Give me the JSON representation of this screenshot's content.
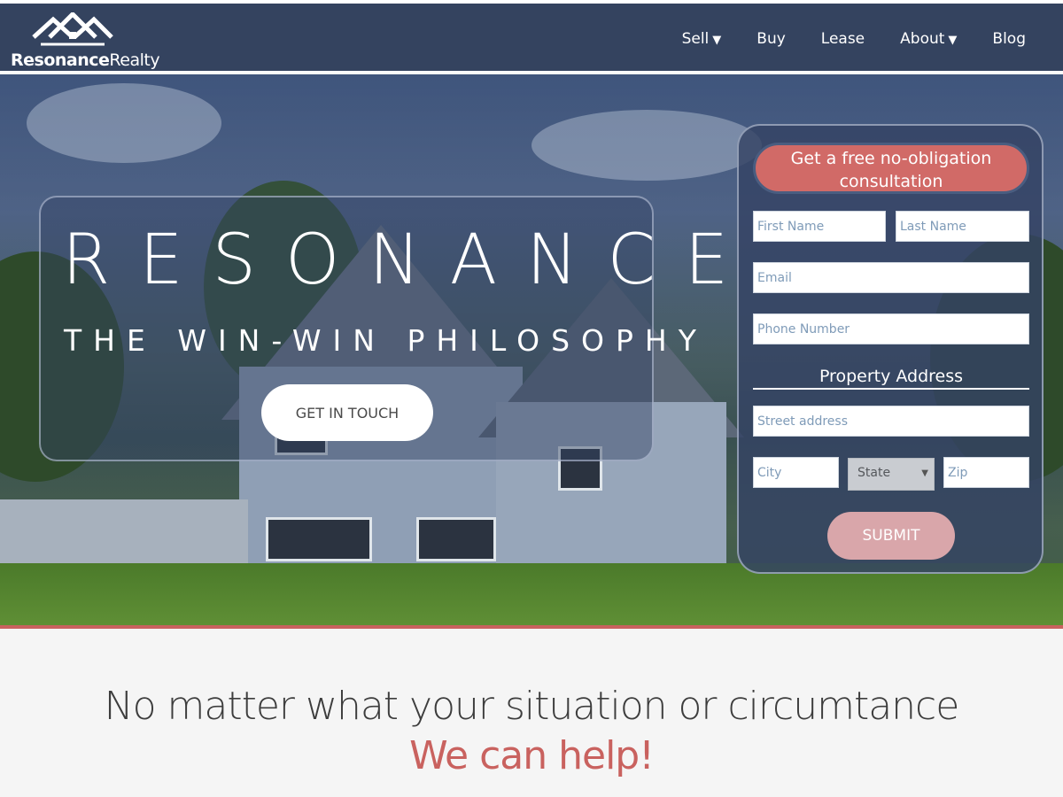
{
  "brand": {
    "name_bold": "Resonance",
    "name_light": "Realty",
    "logo_icon": "house-roofs-icon"
  },
  "nav": {
    "items": [
      {
        "label": "Sell",
        "has_dropdown": true
      },
      {
        "label": "Buy",
        "has_dropdown": false
      },
      {
        "label": "Lease",
        "has_dropdown": false
      },
      {
        "label": "About",
        "has_dropdown": true
      },
      {
        "label": "Blog",
        "has_dropdown": false
      }
    ],
    "caret": "▼"
  },
  "hero": {
    "title": "RESONANCE",
    "subtitle": "THE WIN-WIN PHILOSOPHY",
    "cta_label": "GET IN TOUCH"
  },
  "form": {
    "heading": "Get a free no-obligation consultation",
    "first_name_placeholder": "First Name",
    "last_name_placeholder": "Last Name",
    "email_placeholder": "Email",
    "phone_placeholder": "Phone Number",
    "address_section_label": "Property Address",
    "street_placeholder": "Street address",
    "city_placeholder": "City",
    "state_value": "State",
    "zip_placeholder": "Zip",
    "submit_label": "SUBMIT"
  },
  "lower": {
    "line1": "No matter what your situation or circumtance",
    "line2": "We can help!"
  },
  "colors": {
    "navbar": "#34435f",
    "accent": "#c9625f",
    "form_heading": "#d16a67",
    "submit": "#d9a6aa"
  }
}
